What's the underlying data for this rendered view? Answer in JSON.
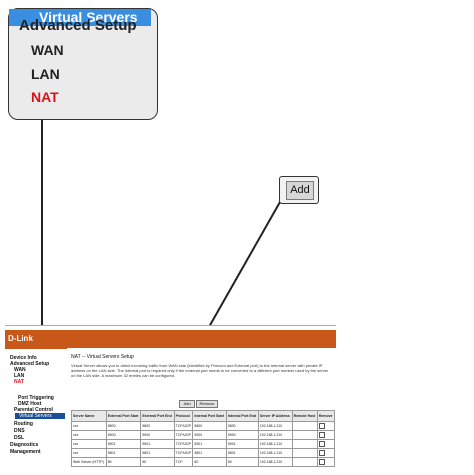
{
  "callout_menu": {
    "title": "Advanced Setup",
    "items": [
      "WAN",
      "LAN",
      "NAT",
      "Virtual Servers"
    ]
  },
  "callout_add": {
    "label": "Add"
  },
  "router_page": {
    "logo": "D-Link",
    "sidebar": {
      "device_info": "Device Info",
      "advanced_setup": "Advanced Setup",
      "wan": "WAN",
      "lan": "LAN",
      "nat": "NAT",
      "virtual_servers": "Virtual Servers",
      "port_triggering": "Port Triggering",
      "dmz_host": "DMZ Host",
      "parental_control": "Parental Control",
      "routing": "Routing",
      "dns": "DNS",
      "dsl": "DSL",
      "diagnostics": "Diagnostics",
      "management": "Management"
    },
    "title": "NAT -- Virtual Servers Setup",
    "description": "Virtual Server allows you to direct incoming traffic from WAN side (identified by Protocol and External port) to the Internal server with private IP address on the LAN side. The Internal port is required only if the external port needs to be converted to a different port number used by the server on the LAN side. A maximum 32 entries can be configured.",
    "buttons": {
      "add": "Add",
      "remove": "Remove"
    },
    "table": {
      "headers": [
        "Server Name",
        "External Port Start",
        "External Port End",
        "Protocol",
        "Internal Port Start",
        "Internal Port End",
        "Server IP Address",
        "Remote Host",
        "Remove"
      ],
      "rows": [
        [
          "xxx",
          "5800",
          "5800",
          "TCP/UDP",
          "5800",
          "5800",
          "192.168.1.210",
          "",
          ""
        ],
        [
          "xxx",
          "5900",
          "5900",
          "TCP/UDP",
          "5900",
          "5900",
          "192.168.1.210",
          "",
          ""
        ],
        [
          "xxx",
          "5901",
          "5901",
          "TCP/UDP",
          "5901",
          "5901",
          "192.168.1.210",
          "",
          ""
        ],
        [
          "xxx",
          "5801",
          "5801",
          "TCP/UDP",
          "5801",
          "5801",
          "192.168.1.210",
          "",
          ""
        ],
        [
          "Web Server (HTTP)",
          "80",
          "80",
          "TCP",
          "80",
          "80",
          "192.168.1.210",
          "",
          ""
        ]
      ]
    }
  }
}
